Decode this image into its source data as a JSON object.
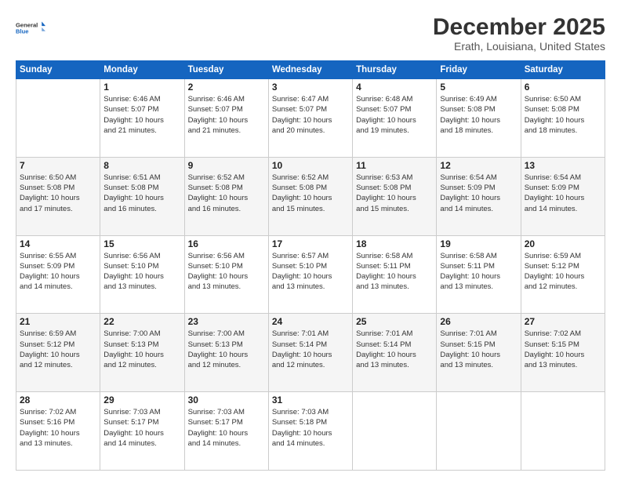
{
  "header": {
    "logo_line1": "General",
    "logo_line2": "Blue",
    "month": "December 2025",
    "location": "Erath, Louisiana, United States"
  },
  "days_of_week": [
    "Sunday",
    "Monday",
    "Tuesday",
    "Wednesday",
    "Thursday",
    "Friday",
    "Saturday"
  ],
  "weeks": [
    [
      {
        "num": "",
        "info": ""
      },
      {
        "num": "1",
        "info": "Sunrise: 6:46 AM\nSunset: 5:07 PM\nDaylight: 10 hours\nand 21 minutes."
      },
      {
        "num": "2",
        "info": "Sunrise: 6:46 AM\nSunset: 5:07 PM\nDaylight: 10 hours\nand 21 minutes."
      },
      {
        "num": "3",
        "info": "Sunrise: 6:47 AM\nSunset: 5:07 PM\nDaylight: 10 hours\nand 20 minutes."
      },
      {
        "num": "4",
        "info": "Sunrise: 6:48 AM\nSunset: 5:07 PM\nDaylight: 10 hours\nand 19 minutes."
      },
      {
        "num": "5",
        "info": "Sunrise: 6:49 AM\nSunset: 5:08 PM\nDaylight: 10 hours\nand 18 minutes."
      },
      {
        "num": "6",
        "info": "Sunrise: 6:50 AM\nSunset: 5:08 PM\nDaylight: 10 hours\nand 18 minutes."
      }
    ],
    [
      {
        "num": "7",
        "info": "Sunrise: 6:50 AM\nSunset: 5:08 PM\nDaylight: 10 hours\nand 17 minutes."
      },
      {
        "num": "8",
        "info": "Sunrise: 6:51 AM\nSunset: 5:08 PM\nDaylight: 10 hours\nand 16 minutes."
      },
      {
        "num": "9",
        "info": "Sunrise: 6:52 AM\nSunset: 5:08 PM\nDaylight: 10 hours\nand 16 minutes."
      },
      {
        "num": "10",
        "info": "Sunrise: 6:52 AM\nSunset: 5:08 PM\nDaylight: 10 hours\nand 15 minutes."
      },
      {
        "num": "11",
        "info": "Sunrise: 6:53 AM\nSunset: 5:08 PM\nDaylight: 10 hours\nand 15 minutes."
      },
      {
        "num": "12",
        "info": "Sunrise: 6:54 AM\nSunset: 5:09 PM\nDaylight: 10 hours\nand 14 minutes."
      },
      {
        "num": "13",
        "info": "Sunrise: 6:54 AM\nSunset: 5:09 PM\nDaylight: 10 hours\nand 14 minutes."
      }
    ],
    [
      {
        "num": "14",
        "info": "Sunrise: 6:55 AM\nSunset: 5:09 PM\nDaylight: 10 hours\nand 14 minutes."
      },
      {
        "num": "15",
        "info": "Sunrise: 6:56 AM\nSunset: 5:10 PM\nDaylight: 10 hours\nand 13 minutes."
      },
      {
        "num": "16",
        "info": "Sunrise: 6:56 AM\nSunset: 5:10 PM\nDaylight: 10 hours\nand 13 minutes."
      },
      {
        "num": "17",
        "info": "Sunrise: 6:57 AM\nSunset: 5:10 PM\nDaylight: 10 hours\nand 13 minutes."
      },
      {
        "num": "18",
        "info": "Sunrise: 6:58 AM\nSunset: 5:11 PM\nDaylight: 10 hours\nand 13 minutes."
      },
      {
        "num": "19",
        "info": "Sunrise: 6:58 AM\nSunset: 5:11 PM\nDaylight: 10 hours\nand 13 minutes."
      },
      {
        "num": "20",
        "info": "Sunrise: 6:59 AM\nSunset: 5:12 PM\nDaylight: 10 hours\nand 12 minutes."
      }
    ],
    [
      {
        "num": "21",
        "info": "Sunrise: 6:59 AM\nSunset: 5:12 PM\nDaylight: 10 hours\nand 12 minutes."
      },
      {
        "num": "22",
        "info": "Sunrise: 7:00 AM\nSunset: 5:13 PM\nDaylight: 10 hours\nand 12 minutes."
      },
      {
        "num": "23",
        "info": "Sunrise: 7:00 AM\nSunset: 5:13 PM\nDaylight: 10 hours\nand 12 minutes."
      },
      {
        "num": "24",
        "info": "Sunrise: 7:01 AM\nSunset: 5:14 PM\nDaylight: 10 hours\nand 12 minutes."
      },
      {
        "num": "25",
        "info": "Sunrise: 7:01 AM\nSunset: 5:14 PM\nDaylight: 10 hours\nand 13 minutes."
      },
      {
        "num": "26",
        "info": "Sunrise: 7:01 AM\nSunset: 5:15 PM\nDaylight: 10 hours\nand 13 minutes."
      },
      {
        "num": "27",
        "info": "Sunrise: 7:02 AM\nSunset: 5:15 PM\nDaylight: 10 hours\nand 13 minutes."
      }
    ],
    [
      {
        "num": "28",
        "info": "Sunrise: 7:02 AM\nSunset: 5:16 PM\nDaylight: 10 hours\nand 13 minutes."
      },
      {
        "num": "29",
        "info": "Sunrise: 7:03 AM\nSunset: 5:17 PM\nDaylight: 10 hours\nand 14 minutes."
      },
      {
        "num": "30",
        "info": "Sunrise: 7:03 AM\nSunset: 5:17 PM\nDaylight: 10 hours\nand 14 minutes."
      },
      {
        "num": "31",
        "info": "Sunrise: 7:03 AM\nSunset: 5:18 PM\nDaylight: 10 hours\nand 14 minutes."
      },
      {
        "num": "",
        "info": ""
      },
      {
        "num": "",
        "info": ""
      },
      {
        "num": "",
        "info": ""
      }
    ]
  ]
}
